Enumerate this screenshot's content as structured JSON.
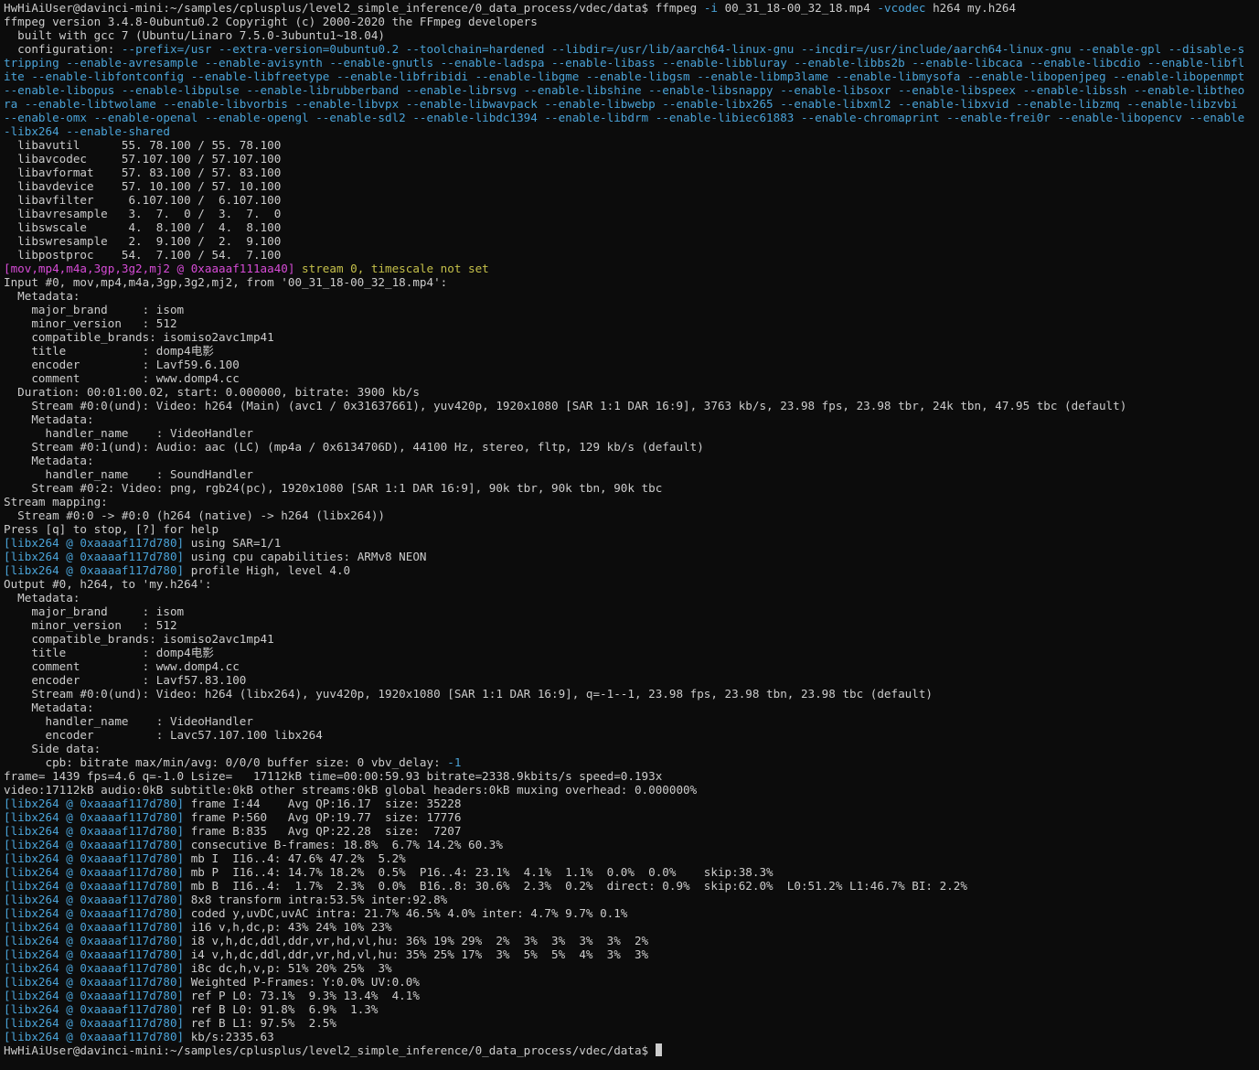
{
  "prompt": {
    "text": "HwHiAiUser@davinci-mini:~/samples/cplusplus/level2_simple_inference/0_data_process/vdec/data$ ",
    "command": "ffmpeg",
    "flag_i": "-i",
    "input_file": "00_31_18-00_32_18.mp4",
    "flag_vcodec": "-vcodec",
    "codec": "h264",
    "output_file": "my.h264"
  },
  "header": {
    "version": "ffmpeg version 3.4.8-0ubuntu0.2 Copyright (c) 2000-2020 the FFmpeg developers",
    "built": "  built with gcc 7 (Ubuntu/Linaro 7.5.0-3ubuntu1~18.04)",
    "config_label": "  configuration: ",
    "config_options": "--prefix=/usr --extra-version=0ubuntu0.2 --toolchain=hardened --libdir=/usr/lib/aarch64-linux-gnu --incdir=/usr/include/aarch64-linux-gnu --enable-gpl --disable-stripping --enable-avresample --enable-avisynth --enable-gnutls --enable-ladspa --enable-libass --enable-libbluray --enable-libbs2b --enable-libcaca --enable-libcdio --enable-libflite --enable-libfontconfig --enable-libfreetype --enable-libfribidi --enable-libgme --enable-libgsm --enable-libmp3lame --enable-libmysofa --enable-libopenjpeg --enable-libopenmpt --enable-libopus --enable-libpulse --enable-librubberband --enable-librsvg --enable-libshine --enable-libsnappy --enable-libsoxr --enable-libspeex --enable-libssh --enable-libtheora --enable-libtwolame --enable-libvorbis --enable-libvpx --enable-libwavpack --enable-libwebp --enable-libx265 --enable-libxml2 --enable-libxvid --enable-libzmq --enable-libzvbi --enable-omx --enable-openal --enable-opengl --enable-sdl2 --enable-libdc1394 --enable-libdrm --enable-libiec61883 --enable-chromaprint --enable-frei0r --enable-libopencv --enable-libx264 --enable-shared"
  },
  "libs": [
    "  libavutil      55. 78.100 / 55. 78.100",
    "  libavcodec     57.107.100 / 57.107.100",
    "  libavformat    57. 83.100 / 57. 83.100",
    "  libavdevice    57. 10.100 / 57. 10.100",
    "  libavfilter     6.107.100 /  6.107.100",
    "  libavresample   3.  7.  0 /  3.  7.  0",
    "  libswscale      4.  8.100 /  4.  8.100",
    "  libswresample   2.  9.100 /  2.  9.100",
    "  libpostproc    54.  7.100 / 54.  7.100"
  ],
  "warning": {
    "tag": "[mov,mp4,m4a,3gp,3g2,mj2 @ 0xaaaaf111aa40]",
    "text": " stream 0, timescale not set"
  },
  "input_lines": [
    "Input #0, mov,mp4,m4a,3gp,3g2,mj2, from '00_31_18-00_32_18.mp4':",
    "  Metadata:",
    "    major_brand     : isom",
    "    minor_version   : 512",
    "    compatible_brands: isomiso2avc1mp41",
    "    title           : domp4电影",
    "    encoder         : Lavf59.6.100",
    "    comment         : www.domp4.cc",
    "  Duration: 00:01:00.02, start: 0.000000, bitrate: 3900 kb/s",
    "    Stream #0:0(und): Video: h264 (Main) (avc1 / 0x31637661), yuv420p, 1920x1080 [SAR 1:1 DAR 16:9], 3763 kb/s, 23.98 fps, 23.98 tbr, 24k tbn, 47.95 tbc (default)",
    "    Metadata:",
    "      handler_name    : VideoHandler",
    "    Stream #0:1(und): Audio: aac (LC) (mp4a / 0x6134706D), 44100 Hz, stereo, fltp, 129 kb/s (default)",
    "    Metadata:",
    "      handler_name    : SoundHandler",
    "    Stream #0:2: Video: png, rgb24(pc), 1920x1080 [SAR 1:1 DAR 16:9], 90k tbr, 90k tbn, 90k tbc",
    "Stream mapping:",
    "  Stream #0:0 -> #0:0 (h264 (native) -> h264 (libx264))",
    "Press [q] to stop, [?] for help"
  ],
  "x264_prefix": "[libx264 @ 0xaaaaf117d780]",
  "x264_init": [
    " using SAR=1/1",
    " using cpu capabilities: ARMv8 NEON",
    " profile High, level 4.0"
  ],
  "output_lines": [
    "Output #0, h264, to 'my.h264':",
    "  Metadata:",
    "    major_brand     : isom",
    "    minor_version   : 512",
    "    compatible_brands: isomiso2avc1mp41",
    "    title           : domp4电影",
    "    comment         : www.domp4.cc",
    "    encoder         : Lavf57.83.100",
    "    Stream #0:0(und): Video: h264 (libx264), yuv420p, 1920x1080 [SAR 1:1 DAR 16:9], q=-1--1, 23.98 fps, 23.98 tbn, 23.98 tbc (default)",
    "    Metadata:",
    "      handler_name    : VideoHandler",
    "      encoder         : Lavc57.107.100 libx264",
    "    Side data:"
  ],
  "cpb": {
    "text": "      cpb: bitrate max/min/avg: 0/0/0 buffer size: 0 vbv_delay: ",
    "value": "-1"
  },
  "progress_lines": [
    "frame= 1439 fps=4.6 q=-1.0 Lsize=   17112kB time=00:00:59.93 bitrate=2338.9kbits/s speed=0.193x",
    "video:17112kB audio:0kB subtitle:0kB other streams:0kB global headers:0kB muxing overhead: 0.000000%"
  ],
  "x264_stats": [
    " frame I:44    Avg QP:16.17  size: 35228",
    " frame P:560   Avg QP:19.77  size: 17776",
    " frame B:835   Avg QP:22.28  size:  7207",
    " consecutive B-frames: 18.8%  6.7% 14.2% 60.3%",
    " mb I  I16..4: 47.6% 47.2%  5.2%",
    " mb P  I16..4: 14.7% 18.2%  0.5%  P16..4: 23.1%  4.1%  1.1%  0.0%  0.0%    skip:38.3%",
    " mb B  I16..4:  1.7%  2.3%  0.0%  B16..8: 30.6%  2.3%  0.2%  direct: 0.9%  skip:62.0%  L0:51.2% L1:46.7% BI: 2.2%",
    " 8x8 transform intra:53.5% inter:92.8%",
    " coded y,uvDC,uvAC intra: 21.7% 46.5% 4.0% inter: 4.7% 9.7% 0.1%",
    " i16 v,h,dc,p: 43% 24% 10% 23%",
    " i8 v,h,dc,ddl,ddr,vr,hd,vl,hu: 36% 19% 29%  2%  3%  3%  3%  3%  2%",
    " i4 v,h,dc,ddl,ddr,vr,hd,vl,hu: 35% 25% 17%  3%  5%  5%  4%  3%  3%",
    " i8c dc,h,v,p: 51% 20% 25%  3%",
    " Weighted P-Frames: Y:0.0% UV:0.0%",
    " ref P L0: 73.1%  9.3% 13.4%  4.1%",
    " ref B L0: 91.8%  6.9%  1.3%",
    " ref B L1: 97.5%  2.5%",
    " kb/s:2335.63"
  ],
  "final_prompt": "HwHiAiUser@davinci-mini:~/samples/cplusplus/level2_simple_inference/0_data_process/vdec/data$ ",
  "colors": {
    "background": "#0c0c0c",
    "foreground": "#cccccc",
    "option_blue": "#4aa3d8",
    "tag_magenta": "#d64bd6",
    "warn_yellow": "#c5c04a"
  }
}
